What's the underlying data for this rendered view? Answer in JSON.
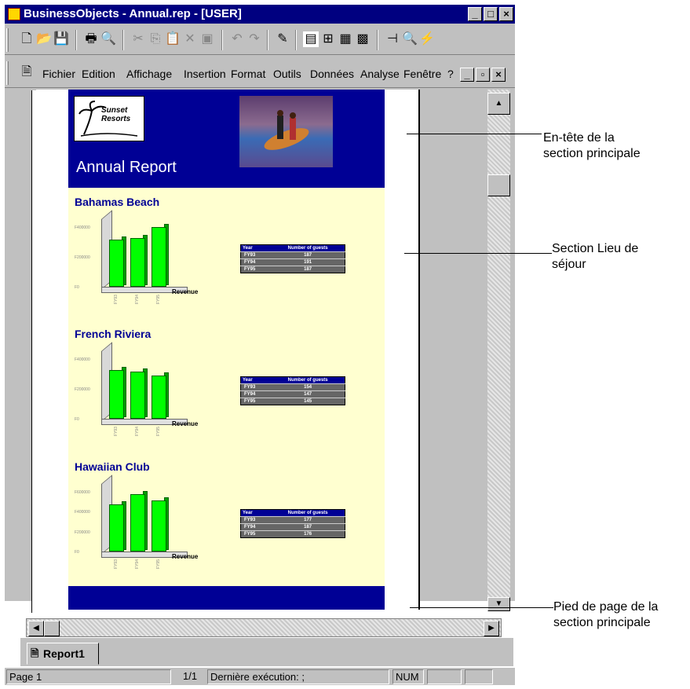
{
  "window": {
    "title": "BusinessObjects - Annual.rep - [USER]",
    "min": "_",
    "max": "□",
    "close": "×"
  },
  "menu": {
    "items": [
      "Fichier",
      "Edition",
      "Affichage",
      "Insertion",
      "Format",
      "Outils",
      "Données",
      "Analyse",
      "Fenêtre",
      "?"
    ],
    "doc_min": "_",
    "doc_restore": "▫",
    "doc_close": "×"
  },
  "report": {
    "header_title": "Annual Report",
    "logo_text": "Sunset Resorts",
    "resorts": [
      {
        "name": "Bahamas Beach",
        "axis": [
          "F400000",
          "F200000",
          "F0"
        ],
        "years": [
          "FY93",
          "FY94",
          "FY95"
        ],
        "guests": [
          "187",
          "191",
          "187"
        ]
      },
      {
        "name": "French Riviera",
        "axis": [
          "F400000",
          "F200000",
          "F0"
        ],
        "years": [
          "FY93",
          "FY94",
          "FY95"
        ],
        "guests": [
          "154",
          "147",
          "145"
        ]
      },
      {
        "name": "Hawaiian Club",
        "axis": [
          "F600000",
          "F400000",
          "F200000",
          "F0"
        ],
        "years": [
          "FY93",
          "FY94",
          "FY95"
        ],
        "guests": [
          "177",
          "187",
          "176"
        ]
      }
    ],
    "chart_label": "Revenue",
    "table_header": [
      "Year",
      "Number of guests"
    ]
  },
  "tab": {
    "label": "Report1"
  },
  "status": {
    "page": "Page 1",
    "pages": "1/1",
    "last_run": "Dernière exécution: ;",
    "num": "NUM"
  },
  "annotations": {
    "header": "En-tête de la\nsection principale",
    "section": "Section Lieu de\nséjour",
    "footer": "Pied de page de la\nsection principale"
  }
}
